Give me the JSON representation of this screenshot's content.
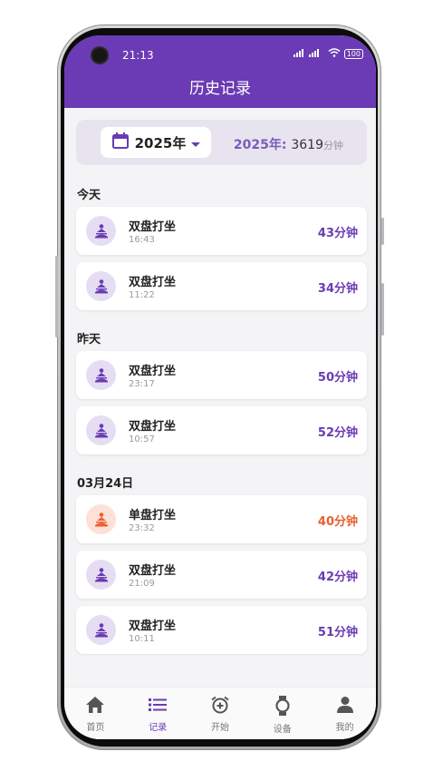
{
  "status": {
    "time": "21:13",
    "signal": "ᴴᴰıl ıl",
    "battery": "100"
  },
  "header": {
    "title": "历史记录"
  },
  "filter": {
    "year_label": "2025年",
    "total_label": "2025年:",
    "total_value": "3619",
    "total_unit": "分钟"
  },
  "groups": [
    {
      "label": "今天"
    },
    {
      "label": "昨天"
    },
    {
      "label": "03月24日"
    }
  ],
  "records": [
    {
      "name": "双盘打坐",
      "time": "16:43",
      "duration": "43分钟"
    },
    {
      "name": "双盘打坐",
      "time": "11:22",
      "duration": "34分钟"
    },
    {
      "name": "双盘打坐",
      "time": "23:17",
      "duration": "50分钟"
    },
    {
      "name": "双盘打坐",
      "time": "10:57",
      "duration": "52分钟"
    },
    {
      "name": "单盘打坐",
      "time": "23:32",
      "duration": "40分钟"
    },
    {
      "name": "双盘打坐",
      "time": "21:09",
      "duration": "42分钟"
    },
    {
      "name": "双盘打坐",
      "time": "10:11",
      "duration": "51分钟"
    }
  ],
  "tabs": [
    {
      "label": "首页",
      "icon": "home-icon"
    },
    {
      "label": "记录",
      "icon": "list-icon"
    },
    {
      "label": "开始",
      "icon": "alarm-clock-icon"
    },
    {
      "label": "设备",
      "icon": "watch-icon"
    },
    {
      "label": "我的",
      "icon": "person-icon"
    }
  ],
  "colors": {
    "accent": "#6a3bb4",
    "single_lotus": "#e8602f",
    "double_lotus": "#6a3bb4"
  }
}
